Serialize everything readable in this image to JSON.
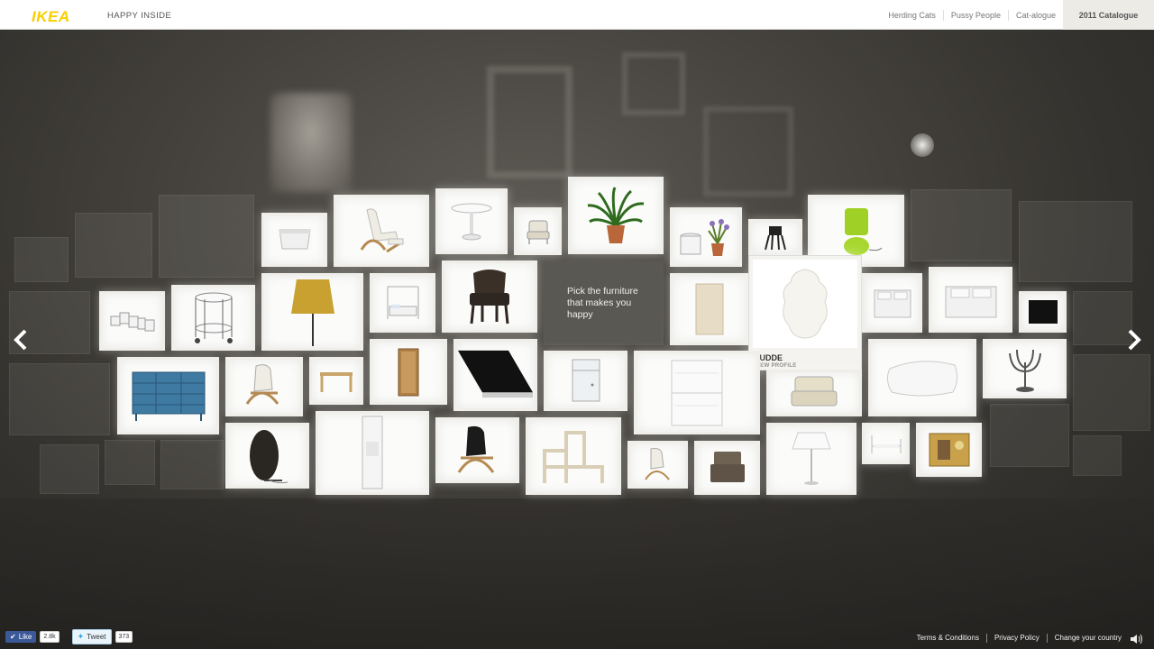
{
  "header": {
    "logo": "IKEA",
    "tagline": "HAPPY INSIDE",
    "nav": [
      "Herding Cats",
      "Pussy People",
      "Cat-alogue"
    ],
    "catalogue": "2011 Catalogue"
  },
  "main": {
    "intro_text": "Pick the furniture that makes you happy",
    "profile": {
      "name": "LUDDE",
      "link": "VIEW PROFILE"
    }
  },
  "footer": {
    "like_label": "Like",
    "like_count": "2.8k",
    "tweet_label": "Tweet",
    "tweet_count": "373",
    "links": [
      "Terms & Conditions",
      "Privacy Policy",
      "Change your country"
    ]
  },
  "icons": {
    "prev": "chevron-left-icon",
    "next": "chevron-right-icon",
    "sound": "speaker-icon"
  },
  "colors": {
    "brand_yellow": "#f8cf00",
    "facebook_blue": "#3b5998"
  }
}
